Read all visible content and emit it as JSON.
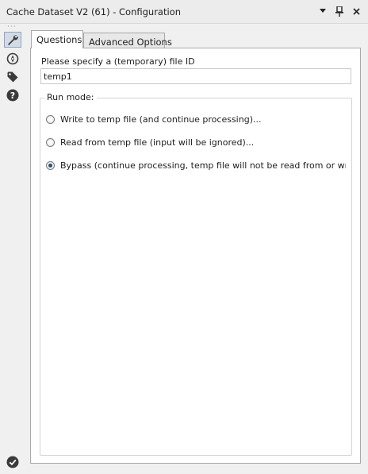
{
  "window": {
    "title": "Cache Dataset V2 (61) - Configuration"
  },
  "tabs": [
    {
      "label": "Questions",
      "active": true
    },
    {
      "label": "Advanced Options",
      "active": false
    }
  ],
  "file_id": {
    "label": "Please specify a (temporary) file ID",
    "value": "temp1"
  },
  "run_mode": {
    "legend": "Run mode:",
    "options": [
      {
        "label": "Write to temp file (and continue processing)...",
        "selected": false
      },
      {
        "label": "Read from temp file (input will be ignored)...",
        "selected": false
      },
      {
        "label": "Bypass (continue processing, temp file will not be read from or written to",
        "selected": true
      }
    ]
  },
  "sidebar_icons": [
    "wrench-icon",
    "compass-icon",
    "tag-icon",
    "help-icon"
  ],
  "footer_icon": "check-circle-icon",
  "colors": {
    "accent": "#2b4f7a",
    "icon": "#3a3a3a"
  }
}
